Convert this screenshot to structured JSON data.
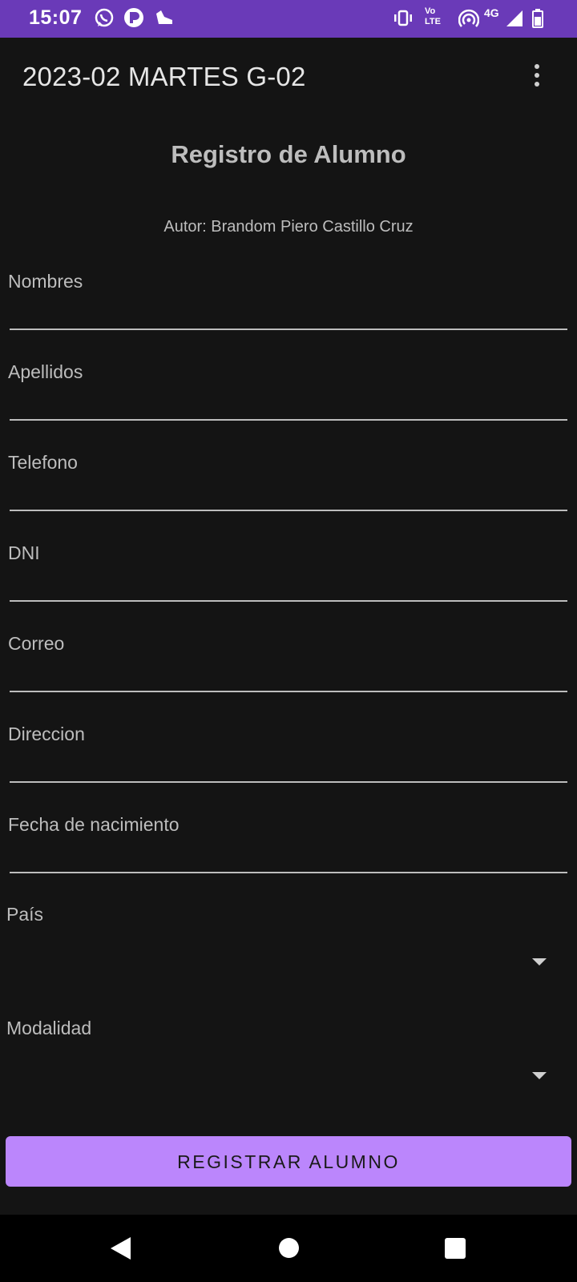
{
  "status_bar": {
    "time": "15:07",
    "left_icons": [
      "whatsapp-icon",
      "app-notification-icon",
      "shoe-icon"
    ],
    "right_icons": [
      "vibrate-icon",
      "volte-icon",
      "hotspot-icon",
      "signal-4g-icon",
      "battery-icon"
    ],
    "volte_top": "Vo",
    "volte_bottom": "LTE",
    "network": "4G"
  },
  "app_bar": {
    "title": "2023-02 MARTES G-02",
    "overflow_icon": "more-vert-icon"
  },
  "form": {
    "title": "Registro de Alumno",
    "author": "Autor: Brandom Piero Castillo Cruz",
    "fields": [
      {
        "label": "Nombres",
        "value": ""
      },
      {
        "label": "Apellidos",
        "value": ""
      },
      {
        "label": "Telefono",
        "value": ""
      },
      {
        "label": "DNI",
        "value": ""
      },
      {
        "label": "Correo",
        "value": ""
      },
      {
        "label": "Direccion",
        "value": ""
      },
      {
        "label": "Fecha de nacimiento",
        "value": ""
      }
    ],
    "spinners": [
      {
        "label": "País",
        "selected": ""
      },
      {
        "label": "Modalidad",
        "selected": ""
      }
    ],
    "submit_label": "REGISTRAR ALUMNO"
  },
  "colors": {
    "status_bar": "#6a3ab8",
    "background": "#141414",
    "button": "#bb86fc",
    "text": "#bdbdbd"
  },
  "nav_bar": {
    "buttons": [
      "back-icon",
      "home-icon",
      "recents-icon"
    ]
  }
}
